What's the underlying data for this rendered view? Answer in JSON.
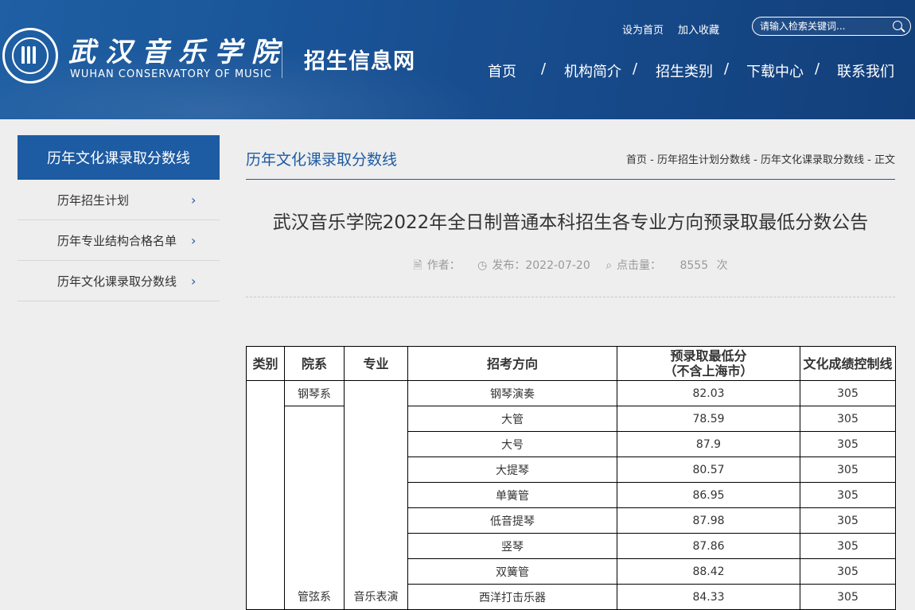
{
  "header": {
    "logo_cn": "武汉音乐学院",
    "logo_en": "WUHAN CONSERVATORY OF MUSIC",
    "site_name": "招生信息网",
    "set_home": "设为首页",
    "add_fav": "加入收藏",
    "search_placeholder": "请输入检索关键词...",
    "nav": [
      "首页",
      "机构简介",
      "招生类别",
      "下载中心",
      "联系我们"
    ],
    "nav_separator": "/"
  },
  "sidebar": {
    "title": "历年文化课录取分数线",
    "items": [
      {
        "label": "历年招生计划"
      },
      {
        "label": "历年专业结构合格名单"
      },
      {
        "label": "历年文化课录取分数线"
      }
    ],
    "chevron": "›"
  },
  "main": {
    "section_title": "历年文化课录取分数线",
    "breadcrumb": [
      "首页",
      "-",
      "历年招生计划分数线",
      "-",
      "历年文化课录取分数线",
      "-",
      "正文"
    ],
    "article_title": "武汉音乐学院2022年全日制普通本科招生各专业方向预录取最低分数公告",
    "meta": {
      "author_label": "作者：",
      "publish": "发布：2022-07-20",
      "clicks_label": "点击量：",
      "clicks": "8555",
      "clicks_unit": "次"
    }
  },
  "table": {
    "headers": {
      "category": "类别",
      "dept": "院系",
      "major": "专业",
      "direction": "招考方向",
      "min_score_line1": "预录取最低分",
      "min_score_line2": "（不含上海市）",
      "culture_line": "文化成绩控制线"
    },
    "dept_piano": "钢琴系",
    "dept_orchestra": "管弦系",
    "major_partial": "音乐表演",
    "rows": [
      {
        "direction": "钢琴演奏",
        "score": "82.03",
        "culture": "305"
      },
      {
        "direction": "大管",
        "score": "78.59",
        "culture": "305"
      },
      {
        "direction": "大号",
        "score": "87.9",
        "culture": "305"
      },
      {
        "direction": "大提琴",
        "score": "80.57",
        "culture": "305"
      },
      {
        "direction": "单簧管",
        "score": "86.95",
        "culture": "305"
      },
      {
        "direction": "低音提琴",
        "score": "87.98",
        "culture": "305"
      },
      {
        "direction": "竖琴",
        "score": "87.86",
        "culture": "305"
      },
      {
        "direction": "双簧管",
        "score": "88.42",
        "culture": "305"
      },
      {
        "direction": "西洋打击乐器",
        "score": "84.33",
        "culture": "305"
      }
    ]
  },
  "colors": {
    "brand_blue": "#1d5ba3",
    "header_bg": "#1a5599",
    "page_bg": "#eeeeee"
  }
}
